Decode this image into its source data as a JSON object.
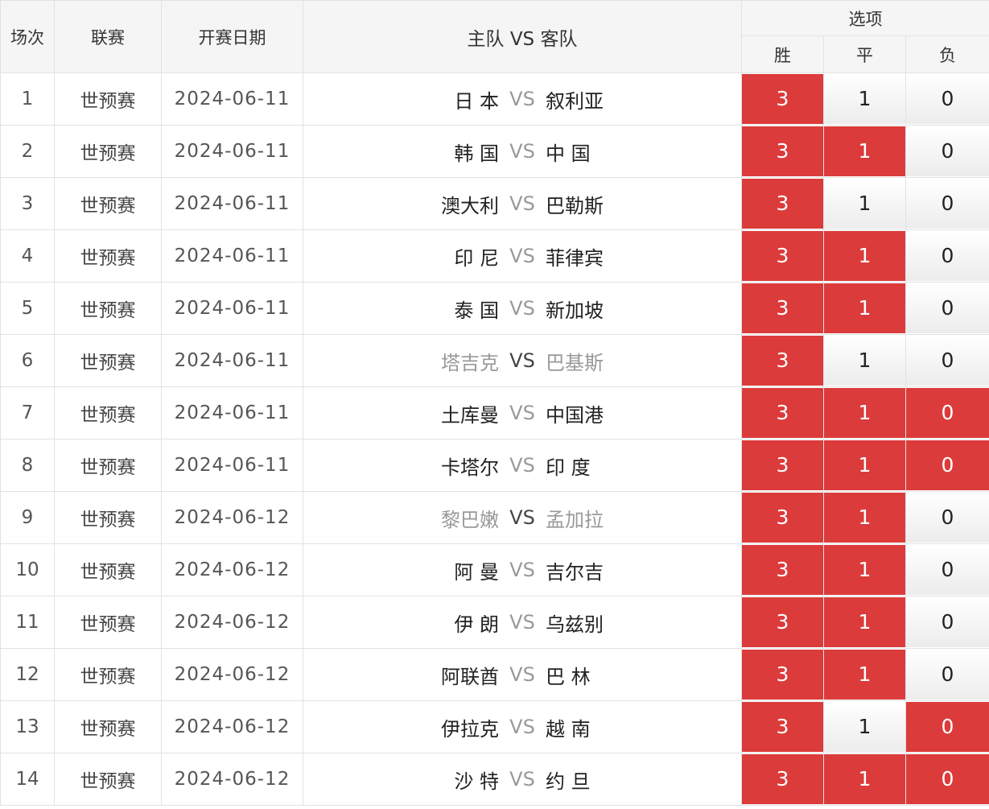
{
  "header": {
    "round": "场次",
    "league": "联赛",
    "date": "开赛日期",
    "match": "主队 VS 客队",
    "options": "选项",
    "win": "胜",
    "draw": "平",
    "lose": "负"
  },
  "colors": {
    "selected": "#dc3b3b",
    "unselected": "#f0f0f0"
  },
  "rows": [
    {
      "no": "1",
      "league": "世预赛",
      "date": "2024-06-11",
      "home": "日 本",
      "vs": "VS",
      "away": "叙利亚",
      "dim": false,
      "win": "3",
      "draw": "1",
      "lose": "0",
      "sel": [
        true,
        false,
        false
      ]
    },
    {
      "no": "2",
      "league": "世预赛",
      "date": "2024-06-11",
      "home": "韩 国",
      "vs": "VS",
      "away": "中 国",
      "dim": false,
      "win": "3",
      "draw": "1",
      "lose": "0",
      "sel": [
        true,
        true,
        false
      ]
    },
    {
      "no": "3",
      "league": "世预赛",
      "date": "2024-06-11",
      "home": "澳大利",
      "vs": "VS",
      "away": "巴勒斯",
      "dim": false,
      "win": "3",
      "draw": "1",
      "lose": "0",
      "sel": [
        true,
        false,
        false
      ]
    },
    {
      "no": "4",
      "league": "世预赛",
      "date": "2024-06-11",
      "home": "印 尼",
      "vs": "VS",
      "away": "菲律宾",
      "dim": false,
      "win": "3",
      "draw": "1",
      "lose": "0",
      "sel": [
        true,
        true,
        false
      ]
    },
    {
      "no": "5",
      "league": "世预赛",
      "date": "2024-06-11",
      "home": "泰 国",
      "vs": "VS",
      "away": "新加坡",
      "dim": false,
      "win": "3",
      "draw": "1",
      "lose": "0",
      "sel": [
        true,
        true,
        false
      ]
    },
    {
      "no": "6",
      "league": "世预赛",
      "date": "2024-06-11",
      "home": "塔吉克",
      "vs": "VS",
      "away": "巴基斯",
      "dim": true,
      "win": "3",
      "draw": "1",
      "lose": "0",
      "sel": [
        true,
        false,
        false
      ]
    },
    {
      "no": "7",
      "league": "世预赛",
      "date": "2024-06-11",
      "home": "土库曼",
      "vs": "VS",
      "away": "中国港",
      "dim": false,
      "win": "3",
      "draw": "1",
      "lose": "0",
      "sel": [
        true,
        true,
        true
      ]
    },
    {
      "no": "8",
      "league": "世预赛",
      "date": "2024-06-11",
      "home": "卡塔尔",
      "vs": "VS",
      "away": "印 度",
      "dim": false,
      "win": "3",
      "draw": "1",
      "lose": "0",
      "sel": [
        true,
        true,
        true
      ]
    },
    {
      "no": "9",
      "league": "世预赛",
      "date": "2024-06-12",
      "home": "黎巴嫩",
      "vs": "VS",
      "away": "孟加拉",
      "dim": true,
      "win": "3",
      "draw": "1",
      "lose": "0",
      "sel": [
        true,
        true,
        false
      ]
    },
    {
      "no": "10",
      "league": "世预赛",
      "date": "2024-06-12",
      "home": "阿 曼",
      "vs": "VS",
      "away": "吉尔吉",
      "dim": false,
      "win": "3",
      "draw": "1",
      "lose": "0",
      "sel": [
        true,
        true,
        false
      ]
    },
    {
      "no": "11",
      "league": "世预赛",
      "date": "2024-06-12",
      "home": "伊 朗",
      "vs": "VS",
      "away": "乌兹别",
      "dim": false,
      "win": "3",
      "draw": "1",
      "lose": "0",
      "sel": [
        true,
        true,
        false
      ]
    },
    {
      "no": "12",
      "league": "世预赛",
      "date": "2024-06-12",
      "home": "阿联酋",
      "vs": "VS",
      "away": "巴 林",
      "dim": false,
      "win": "3",
      "draw": "1",
      "lose": "0",
      "sel": [
        true,
        true,
        false
      ]
    },
    {
      "no": "13",
      "league": "世预赛",
      "date": "2024-06-12",
      "home": "伊拉克",
      "vs": "VS",
      "away": "越 南",
      "dim": false,
      "win": "3",
      "draw": "1",
      "lose": "0",
      "sel": [
        true,
        false,
        true
      ]
    },
    {
      "no": "14",
      "league": "世预赛",
      "date": "2024-06-12",
      "home": "沙 特",
      "vs": "VS",
      "away": "约 旦",
      "dim": false,
      "win": "3",
      "draw": "1",
      "lose": "0",
      "sel": [
        true,
        true,
        true
      ]
    }
  ]
}
